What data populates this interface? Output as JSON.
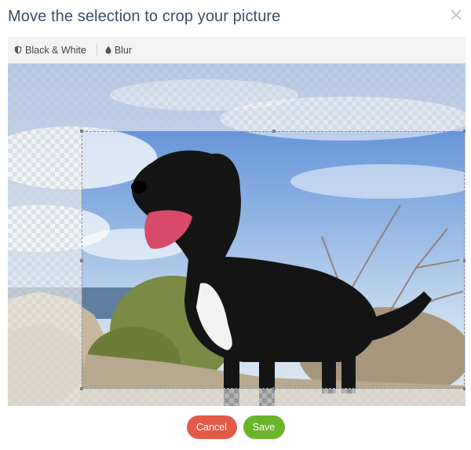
{
  "dialog": {
    "title": "Move the selection to crop your picture"
  },
  "toolbar": {
    "black_white_label": "Black & White",
    "blur_label": "Blur"
  },
  "actions": {
    "cancel_label": "Cancel",
    "save_label": "Save"
  },
  "colors": {
    "title": "#35506a",
    "cancel": "#e35a48",
    "save": "#6ab52c"
  }
}
